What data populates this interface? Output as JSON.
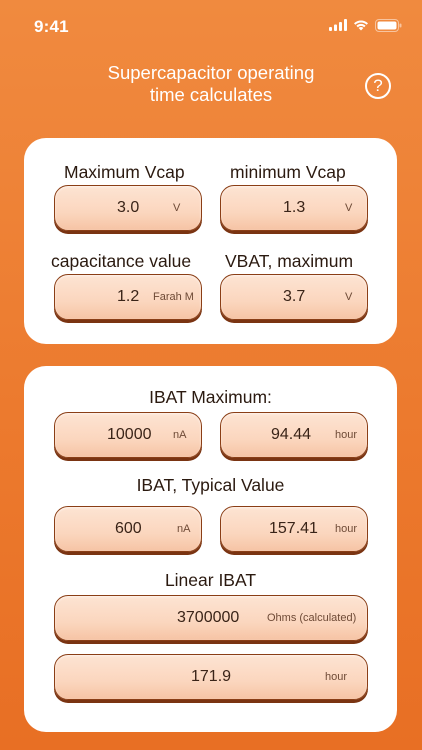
{
  "status": {
    "time": "9:41"
  },
  "header": {
    "title_line1": "Supercapacitor operating",
    "title_line2": "time calculates",
    "help_label": "?"
  },
  "inputs": {
    "max_vcap": {
      "label": "Maximum Vcap",
      "value": "3.0",
      "unit": "V"
    },
    "min_vcap": {
      "label": "minimum Vcap",
      "value": "1.3",
      "unit": "V"
    },
    "capacitance": {
      "label": "capacitance value",
      "value": "1.2",
      "unit": "Farah M"
    },
    "vbat_max": {
      "label": "VBAT, maximum",
      "value": "3.7",
      "unit": "V"
    }
  },
  "results": {
    "ibat_max": {
      "label": "IBAT Maximum:",
      "value": "10000",
      "unit": "nA",
      "time": "94.44",
      "time_unit": "hour"
    },
    "ibat_typ": {
      "label": "IBAT, Typical Value",
      "value": "600",
      "unit": "nA",
      "time": "157.41",
      "time_unit": "hour"
    },
    "linear": {
      "label": "Linear IBAT",
      "ohms": "3700000",
      "ohms_unit": "Ohms (calculated)",
      "time": "171.9",
      "time_unit": "hour"
    }
  },
  "colors": {
    "background": "#ec7a2e",
    "pill_fill": "#fbd6be",
    "pill_border": "#8a3e16"
  }
}
